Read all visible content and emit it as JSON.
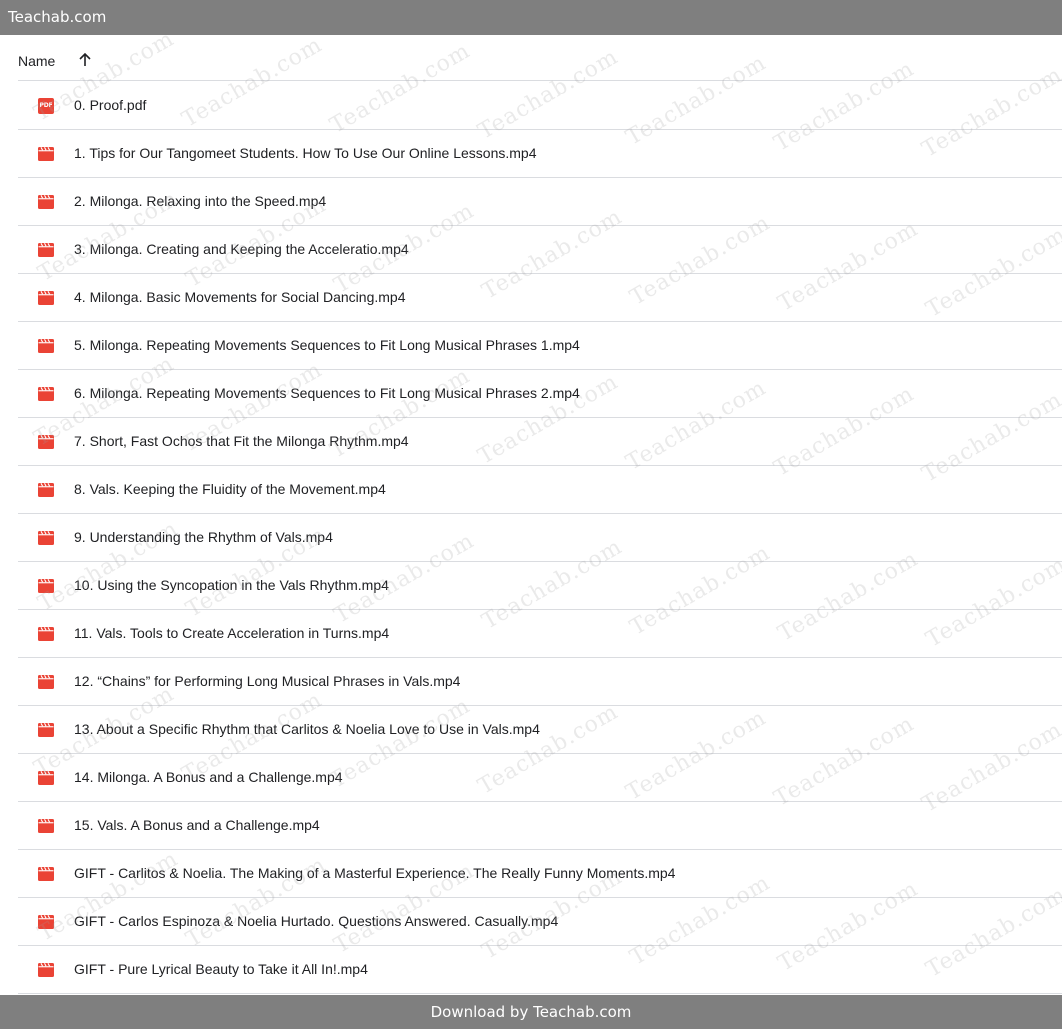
{
  "topbar": {
    "site_name": "Teachab.com"
  },
  "header": {
    "name_column": "Name",
    "sort": "ascending"
  },
  "files": [
    {
      "name": "0. Proof.pdf",
      "type": "pdf",
      "icon": "pdf-icon",
      "icon_label": "PDF"
    },
    {
      "name": "1. Tips for Our Tangomeet Students. How To Use Our Online Lessons.mp4",
      "type": "video",
      "icon": "video-icon"
    },
    {
      "name": "2. Milonga. Relaxing into the Speed.mp4",
      "type": "video",
      "icon": "video-icon"
    },
    {
      "name": "3. Milonga. Creating and Keeping the Acceleratio.mp4",
      "type": "video",
      "icon": "video-icon"
    },
    {
      "name": "4. Milonga. Basic Movements for Social Dancing.mp4",
      "type": "video",
      "icon": "video-icon"
    },
    {
      "name": "5. Milonga. Repeating Movements Sequences to Fit Long Musical Phrases 1.mp4",
      "type": "video",
      "icon": "video-icon"
    },
    {
      "name": "6. Milonga. Repeating Movements Sequences to Fit Long Musical Phrases 2.mp4",
      "type": "video",
      "icon": "video-icon"
    },
    {
      "name": "7. Short, Fast Ochos that Fit the Milonga Rhythm.mp4",
      "type": "video",
      "icon": "video-icon"
    },
    {
      "name": "8. Vals. Keeping the Fluidity of the Movement.mp4",
      "type": "video",
      "icon": "video-icon"
    },
    {
      "name": "9. Understanding the Rhythm of Vals.mp4",
      "type": "video",
      "icon": "video-icon"
    },
    {
      "name": "10. Using the Syncopation in the Vals Rhythm.mp4",
      "type": "video",
      "icon": "video-icon"
    },
    {
      "name": "11. Vals. Tools to Create Acceleration in Turns.mp4",
      "type": "video",
      "icon": "video-icon"
    },
    {
      "name": "12. “Chains” for Performing Long Musical Phrases in Vals.mp4",
      "type": "video",
      "icon": "video-icon"
    },
    {
      "name": "13. About a Specific Rhythm that Carlitos & Noelia Love to Use in Vals.mp4",
      "type": "video",
      "icon": "video-icon"
    },
    {
      "name": "14. Milonga. A Bonus and a Challenge.mp4",
      "type": "video",
      "icon": "video-icon"
    },
    {
      "name": "15. Vals. A Bonus and a Challenge.mp4",
      "type": "video",
      "icon": "video-icon"
    },
    {
      "name": "GIFT - Carlitos & Noelia. The Making of a Masterful Experience. The Really Funny Moments.mp4",
      "type": "video",
      "icon": "video-icon"
    },
    {
      "name": "GIFT - Carlos Espinoza & Noelia Hurtado. Questions Answered. Casually.mp4",
      "type": "video",
      "icon": "video-icon"
    },
    {
      "name": "GIFT - Pure Lyrical Beauty to Take it All In!.mp4",
      "type": "video",
      "icon": "video-icon"
    }
  ],
  "watermark_text": "Teachab.com",
  "footer": {
    "download_text": "Download by Teachab.com"
  },
  "colors": {
    "bar": "#7f7f7f",
    "icon_red": "#ea4335",
    "divider": "#dadce0",
    "text": "#202124"
  }
}
